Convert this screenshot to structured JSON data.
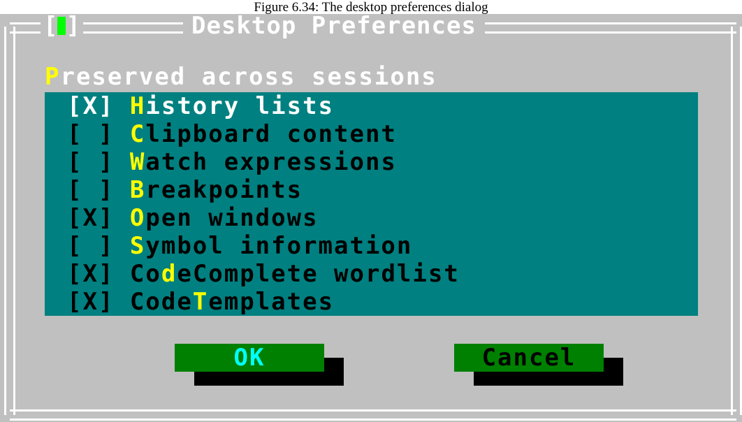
{
  "caption": "Figure 6.34: The desktop preferences dialog",
  "dialog": {
    "title": "Desktop Preferences",
    "close_left": "[",
    "close_right": "]"
  },
  "group": {
    "label_hot": "P",
    "label_rest": "reserved across sessions"
  },
  "items": [
    {
      "mark": "[X]",
      "pre": "",
      "hot": "H",
      "post": "istory lists"
    },
    {
      "mark": "[ ]",
      "pre": "",
      "hot": "C",
      "post": "lipboard content"
    },
    {
      "mark": "[ ]",
      "pre": "",
      "hot": "W",
      "post": "atch expressions"
    },
    {
      "mark": "[ ]",
      "pre": "",
      "hot": "B",
      "post": "reakpoints"
    },
    {
      "mark": "[X]",
      "pre": "",
      "hot": "O",
      "post": "pen windows"
    },
    {
      "mark": "[ ]",
      "pre": "",
      "hot": "S",
      "post": "ymbol information"
    },
    {
      "mark": "[X]",
      "pre": "Co",
      "hot": "d",
      "post": "eComplete wordlist"
    },
    {
      "mark": "[X]",
      "pre": "Code",
      "hot": "T",
      "post": "emplates"
    }
  ],
  "buttons": {
    "ok_label": "OK",
    "cancel_label": "Cancel"
  },
  "colors": {
    "dialog_bg": "#c0c0c0",
    "list_bg": "#008080",
    "hotkey": "#ffff00",
    "button_face": "#008000",
    "ok_text": "#00ffff",
    "cancel_text": "#000000"
  }
}
